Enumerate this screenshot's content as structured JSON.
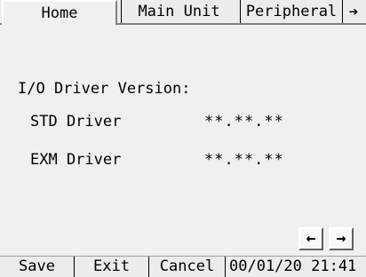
{
  "tabs": {
    "home": "Home",
    "main_unit": "Main Unit",
    "peripheral": "Peripheral",
    "next_icon": "right-arrow-icon"
  },
  "content": {
    "title": "I/O Driver Version:",
    "std_label": "STD Driver",
    "std_value": "**.**.**",
    "exm_label": "EXM Driver",
    "exm_value": "**.**.**"
  },
  "scroll": {
    "left_icon": "left-arrow-icon",
    "right_icon": "right-arrow-icon"
  },
  "bottom": {
    "save": "Save",
    "exit": "Exit",
    "cancel": "Cancel",
    "datetime": "00/01/20 21:41"
  },
  "colors": {
    "background": "#f0f0f0",
    "text": "#000000"
  }
}
